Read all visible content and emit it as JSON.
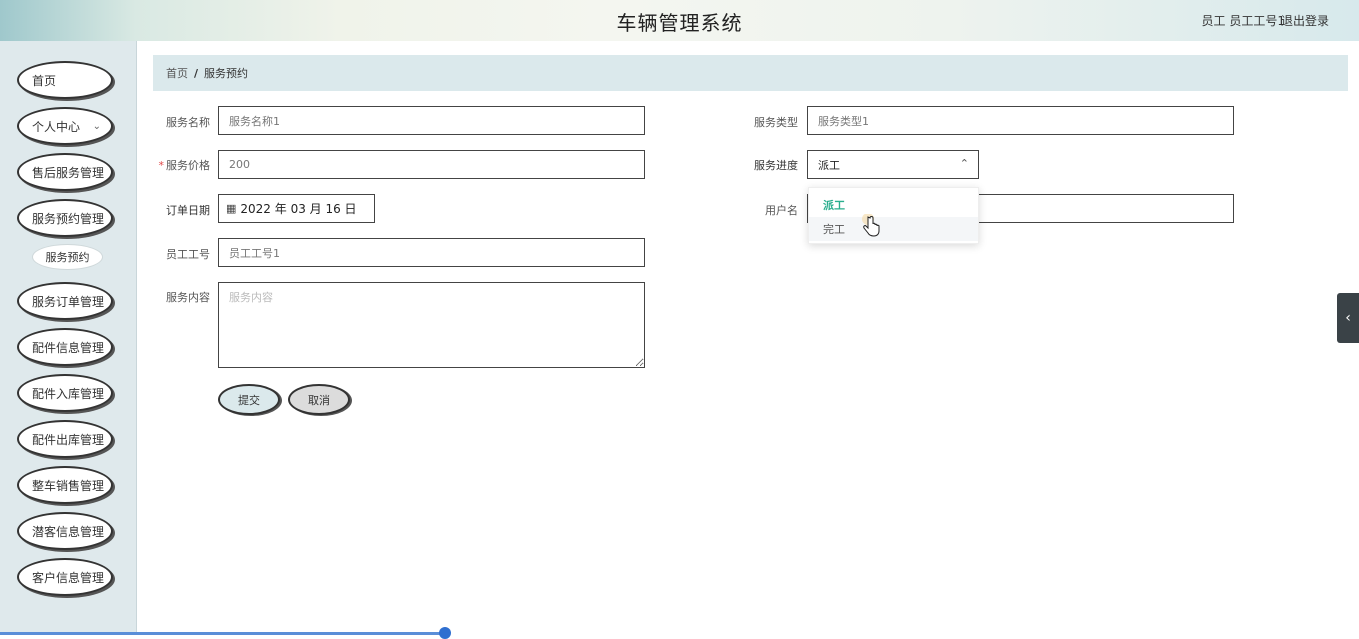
{
  "header": {
    "title": "车辆管理系统",
    "user": "员工  员工工号1",
    "logout": "退出登录"
  },
  "sidebar": {
    "items": [
      {
        "label": "首页"
      },
      {
        "label": "个人中心"
      },
      {
        "label": "售后服务管理"
      },
      {
        "label": "服务预约管理"
      },
      {
        "label": "服务订单管理"
      },
      {
        "label": "配件信息管理"
      },
      {
        "label": "配件入库管理"
      },
      {
        "label": "配件出库管理"
      },
      {
        "label": "整车销售管理"
      },
      {
        "label": "潜客信息管理"
      },
      {
        "label": "客户信息管理"
      }
    ],
    "sub_item": "服务预约"
  },
  "breadcrumb": {
    "home": "首页",
    "separator": "/",
    "current": "服务预约"
  },
  "form": {
    "service_name_label": "服务名称",
    "service_name_value": "服务名称1",
    "service_type_label": "服务类型",
    "service_type_value": "服务类型1",
    "required_mark": "*",
    "price_label": "服务价格",
    "price_value": "200",
    "progress_label": "服务进度",
    "progress_value": "派工",
    "order_date_label": "订单日期",
    "order_date_value": "2022 年 03 月 16 日",
    "username_label": "用户名",
    "staff_no_label": "员工工号",
    "staff_no_value": "员工工号1",
    "content_label": "服务内容",
    "content_placeholder": "服务内容",
    "submit": "提交",
    "cancel": "取消"
  },
  "dropdown": {
    "options": [
      "派工",
      "完工"
    ],
    "selected": "派工"
  },
  "colors": {
    "accent": "#2aae8e",
    "breadcrumb_bg": "#dbe9ec",
    "sidebar_bg": "#dfe9ec"
  }
}
